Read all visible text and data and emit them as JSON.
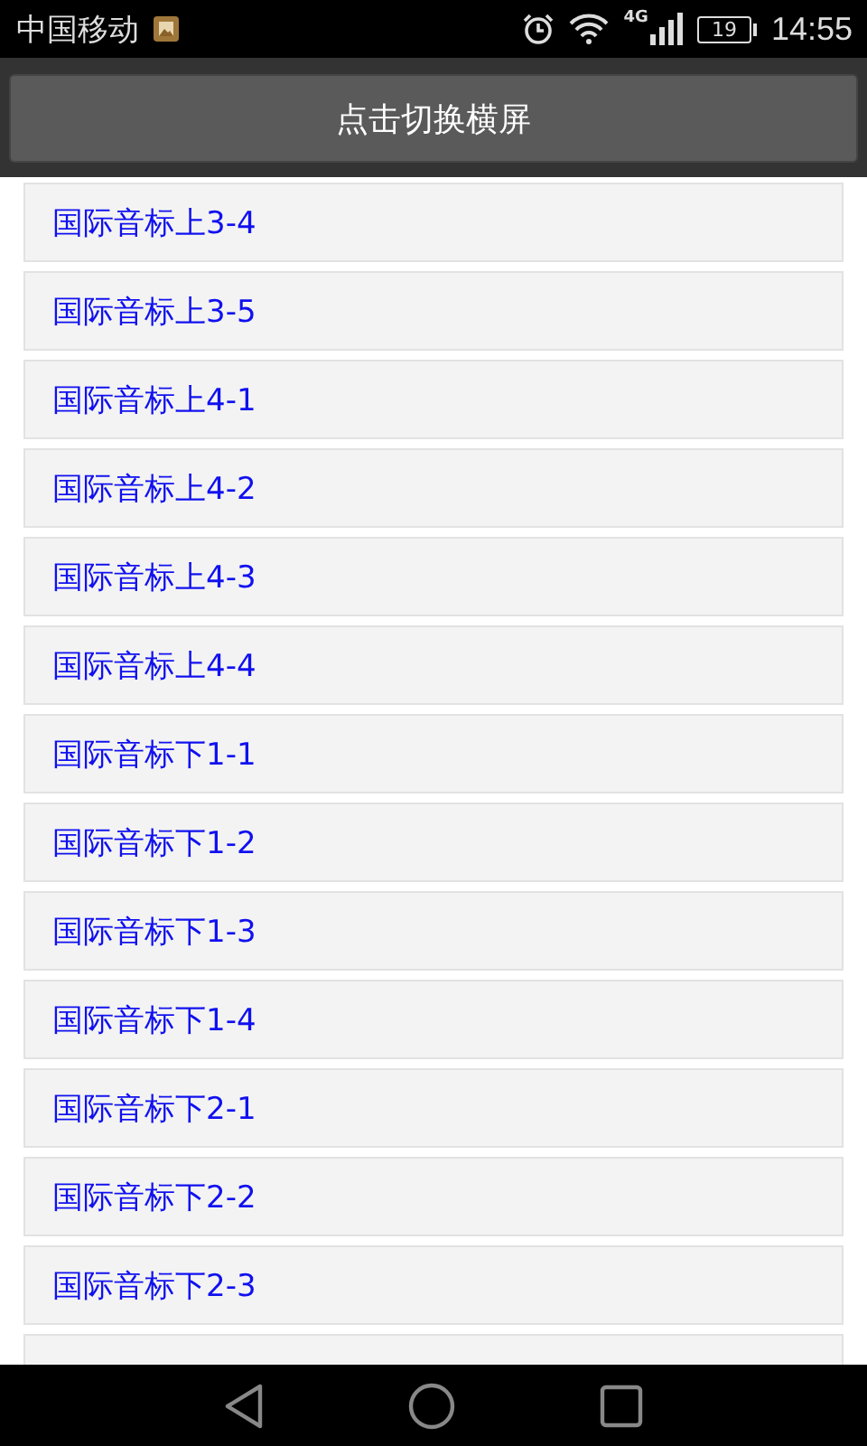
{
  "status_bar": {
    "carrier": "中国移动",
    "network": "4G",
    "battery": "19",
    "time": "14:55"
  },
  "header": {
    "button": "点击切换横屏"
  },
  "list": {
    "items": [
      {
        "label": "国际音标上3-4"
      },
      {
        "label": "国际音标上3-5"
      },
      {
        "label": "国际音标上4-1"
      },
      {
        "label": "国际音标上4-2"
      },
      {
        "label": "国际音标上4-3"
      },
      {
        "label": "国际音标上4-4"
      },
      {
        "label": "国际音标下1-1"
      },
      {
        "label": "国际音标下1-2"
      },
      {
        "label": "国际音标下1-3"
      },
      {
        "label": "国际音标下1-4"
      },
      {
        "label": "国际音标下2-1"
      },
      {
        "label": "国际音标下2-2"
      },
      {
        "label": "国际音标下2-3"
      }
    ]
  }
}
